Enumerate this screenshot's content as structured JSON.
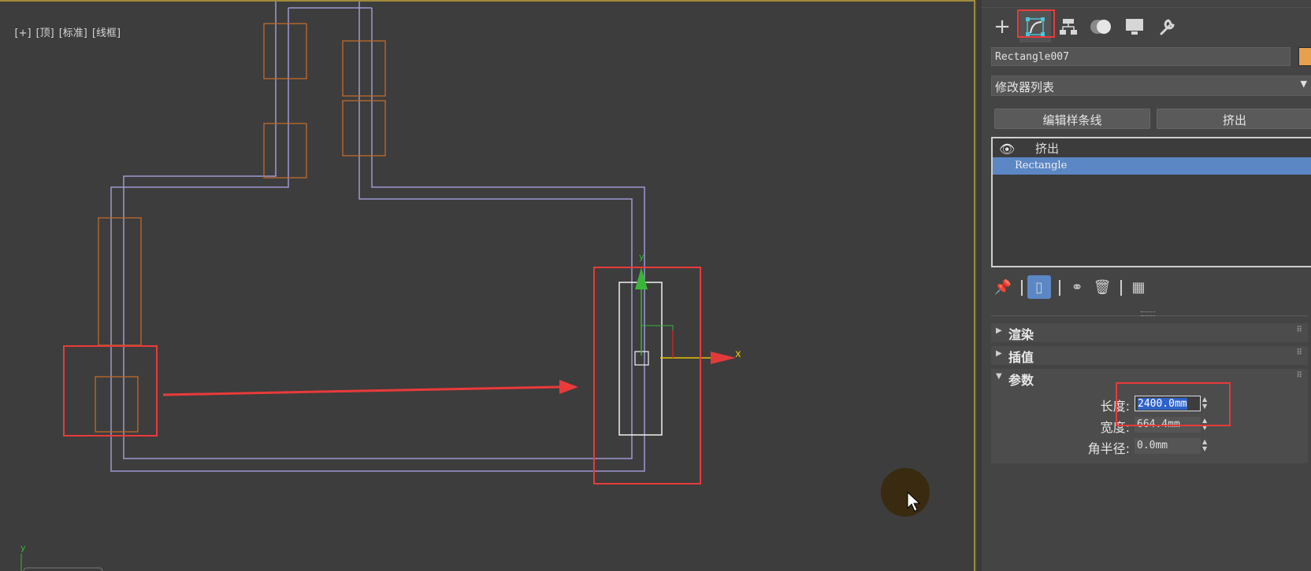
{
  "viewport": {
    "label_parts": [
      "[+]",
      "[顶]",
      "[标准]",
      "[线框]"
    ],
    "gizmo_x_label": "x",
    "gizmo_y_label": "y",
    "corner_axis_label": "y"
  },
  "panel": {
    "tabs": [
      {
        "icon": "create-plus-icon",
        "glyph": "+"
      },
      {
        "icon": "modify-icon",
        "glyph": "◫",
        "active": true
      },
      {
        "icon": "hierarchy-icon",
        "glyph": "⊓"
      },
      {
        "icon": "motion-icon",
        "glyph": "●"
      },
      {
        "icon": "display-icon",
        "glyph": "▭"
      },
      {
        "icon": "utilities-wrench-icon",
        "glyph": "🔧"
      }
    ],
    "object_name": "Rectangle007",
    "object_color": "#e6a04e",
    "modifier_list_label": "修改器列表",
    "quick_buttons": [
      "编辑样条线",
      "挤出"
    ],
    "stack": [
      {
        "label": "挤出",
        "visible_icon": "eye-icon"
      },
      {
        "label": "Rectangle",
        "selected": true
      }
    ],
    "rollouts": [
      "渲染",
      "插值",
      "参数"
    ],
    "parameters": [
      {
        "label": "长度:",
        "value": "2400.0mm",
        "selected": true
      },
      {
        "label": "宽度:",
        "value": "664.4mm"
      },
      {
        "label": "角半径:",
        "value": "0.0mm"
      }
    ]
  },
  "colors": {
    "annotation_red": "#ea3a3a",
    "path_lavender": "#9c9ad2",
    "object_orange": "#c06a2a",
    "selection_blue": "#5b87c5",
    "panel_bg": "#444444",
    "viewport_bg": "#3d3d3d"
  }
}
